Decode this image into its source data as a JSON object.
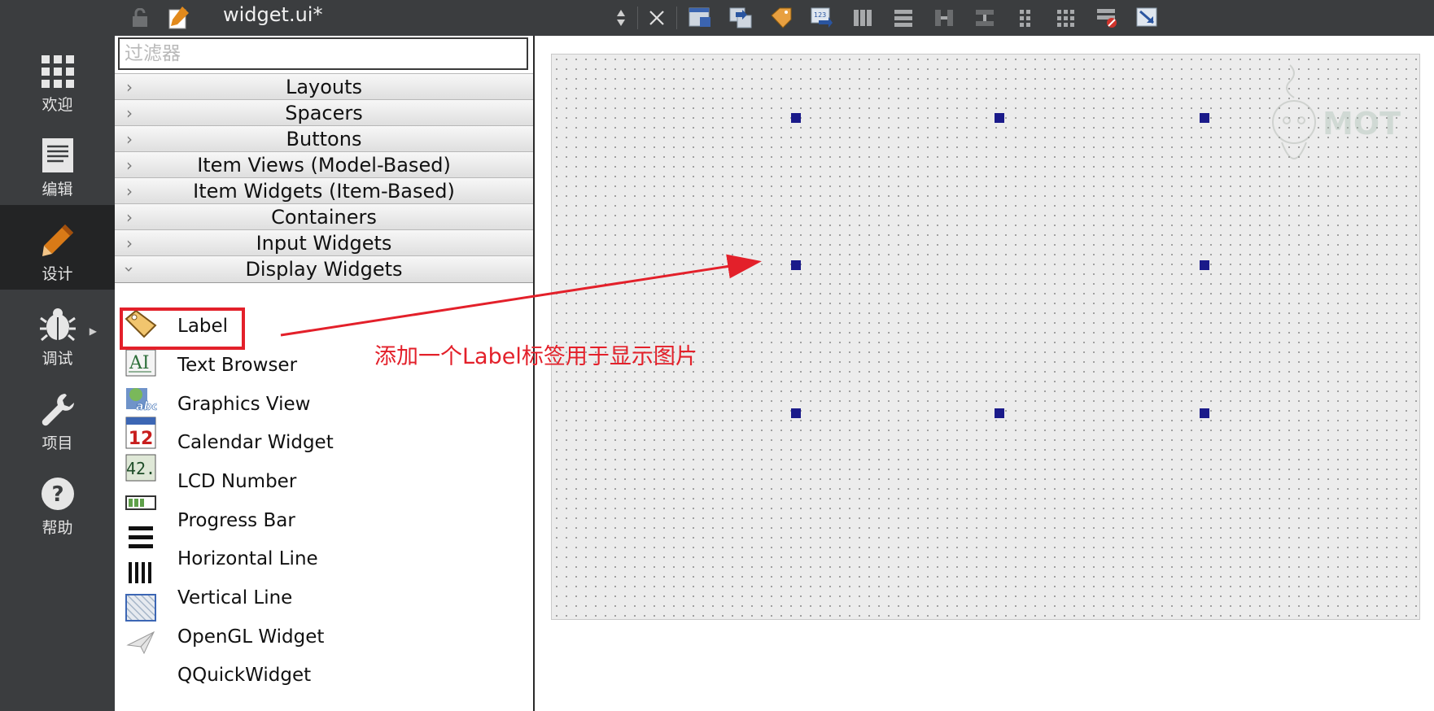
{
  "sidebar": {
    "modes": [
      {
        "label": "欢迎",
        "icon": "grid-icon"
      },
      {
        "label": "编辑",
        "icon": "document-icon"
      },
      {
        "label": "设计",
        "icon": "pencil-icon",
        "active": true
      },
      {
        "label": "调试",
        "icon": "bug-icon"
      },
      {
        "label": "项目",
        "icon": "wrench-icon"
      },
      {
        "label": "帮助",
        "icon": "help-icon"
      }
    ]
  },
  "toolbar": {
    "file_title": "widget.ui*"
  },
  "widgetbox": {
    "filter_placeholder": "过滤器",
    "categories": [
      "Layouts",
      "Spacers",
      "Buttons",
      "Item Views (Model-Based)",
      "Item Widgets (Item-Based)",
      "Containers",
      "Input Widgets",
      "Display Widgets"
    ],
    "display_widgets": [
      {
        "label": "Label",
        "icon": "label-tag-icon"
      },
      {
        "label": "Text Browser",
        "icon": "text-browser-icon"
      },
      {
        "label": "Graphics View",
        "icon": "graphics-view-icon"
      },
      {
        "label": "Calendar Widget",
        "icon": "calendar-icon"
      },
      {
        "label": "LCD Number",
        "icon": "lcd-number-icon"
      },
      {
        "label": "Progress Bar",
        "icon": "progress-bar-icon"
      },
      {
        "label": "Horizontal Line",
        "icon": "horizontal-line-icon"
      },
      {
        "label": "Vertical Line",
        "icon": "vertical-line-icon"
      },
      {
        "label": "OpenGL Widget",
        "icon": "opengl-widget-icon"
      },
      {
        "label": "QQuickWidget",
        "icon": "qquickwidget-icon"
      }
    ],
    "calendar_day": "12",
    "lcd_value": "42."
  },
  "annotation": {
    "text": "添加一个Label标签用于显示图片"
  },
  "colors": {
    "sidebar_bg": "#3b3d3f",
    "active_mode_bg": "#232425",
    "annotation_red": "#e3202a",
    "selection_handle": "#1a1a8a",
    "form_bg": "#ececec"
  }
}
